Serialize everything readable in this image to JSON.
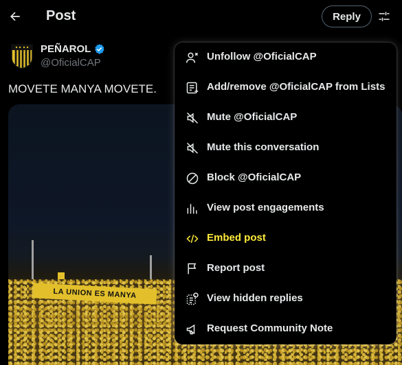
{
  "header": {
    "title": "Post",
    "reply_label": "Reply",
    "back_icon": "arrow-left-icon",
    "filter_icon": "sliders-icon"
  },
  "post": {
    "author_name": "PEÑAROL",
    "author_handle": "@OficialCAP",
    "verified": true,
    "text": "MOVETE MANYA MOVETE.",
    "media_banner_text": "LA UNION ES MANYA"
  },
  "menu": {
    "items": [
      {
        "label": "Unfollow @OficialCAP",
        "icon": "unfollow-icon"
      },
      {
        "label": "Add/remove @OficialCAP from Lists",
        "icon": "list-add-icon"
      },
      {
        "label": "Mute @OficialCAP",
        "icon": "mute-icon"
      },
      {
        "label": "Mute this conversation",
        "icon": "mute-conversation-icon"
      },
      {
        "label": "Block @OficialCAP",
        "icon": "block-icon"
      },
      {
        "label": "View post engagements",
        "icon": "engagements-icon"
      },
      {
        "label": "Embed post",
        "icon": "embed-icon",
        "highlighted": true
      },
      {
        "label": "Report post",
        "icon": "flag-icon"
      },
      {
        "label": "View hidden replies",
        "icon": "hidden-replies-icon"
      },
      {
        "label": "Request Community Note",
        "icon": "megaphone-icon"
      }
    ]
  },
  "colors": {
    "background": "#000000",
    "text": "#e7e9ea",
    "muted": "#71767b",
    "verified": "#1d9bf0",
    "highlight": "#ffeb3b",
    "brand_yellow": "#e3c02b"
  }
}
